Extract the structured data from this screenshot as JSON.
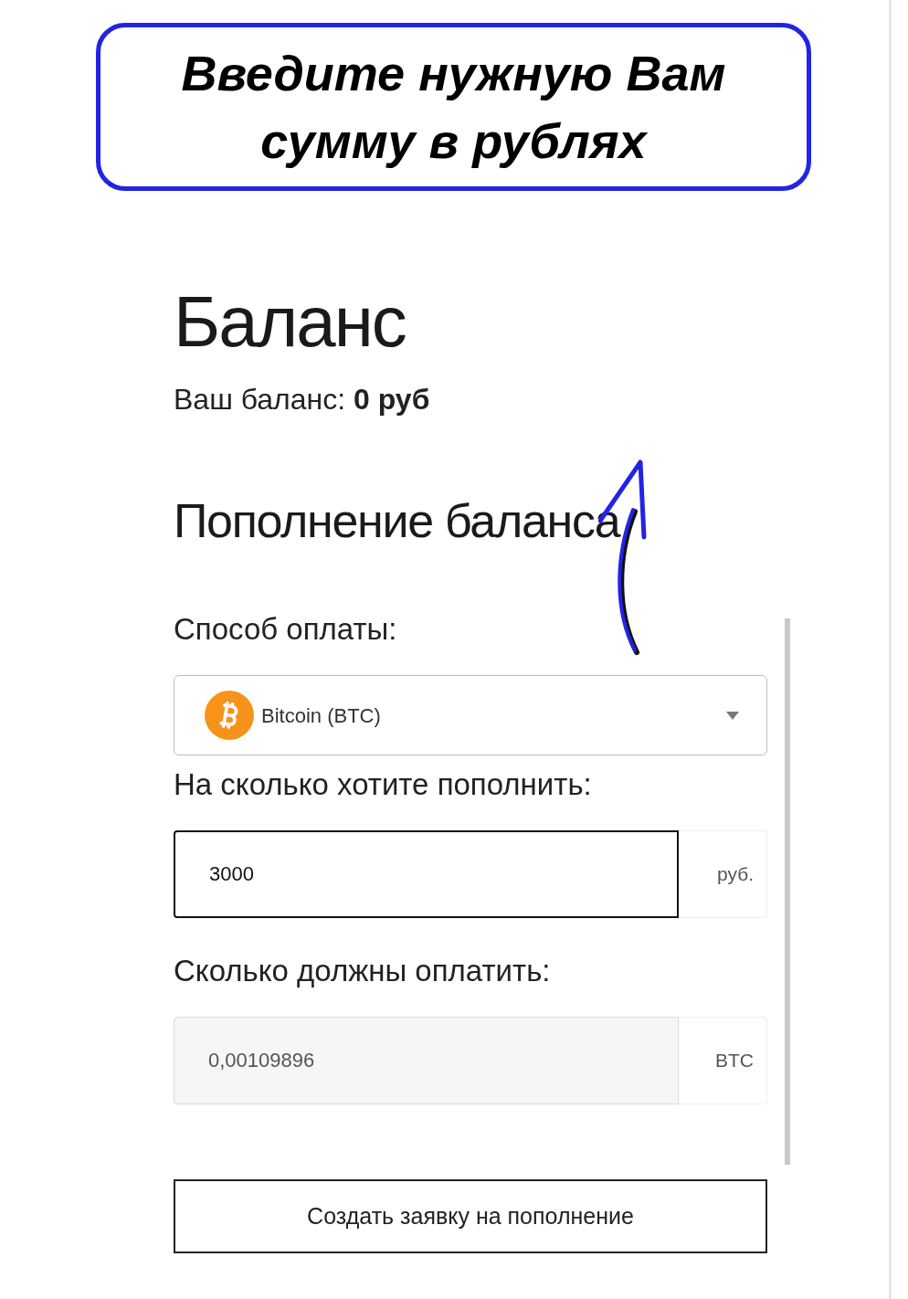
{
  "callout": {
    "text": "Введите нужную Вам сумму в рублях"
  },
  "title": "Баланс",
  "balance": "Ваш баланс: **0 руб**",
  "section_title": "Пополнение баланса",
  "payment_method": {
    "label": "Способ оплаты:",
    "value": "Bitcoin (BTC)"
  },
  "amount": {
    "label": "На сколько хотите пополнить:",
    "value": "3000",
    "unit": "руб.",
    "focused": true
  },
  "payable": {
    "label": "Сколько должны оплатить:",
    "value": "0,00109896",
    "unit": "BTC",
    "disabled": true
  },
  "submit_button": "Создать заявку на пополнение"
}
